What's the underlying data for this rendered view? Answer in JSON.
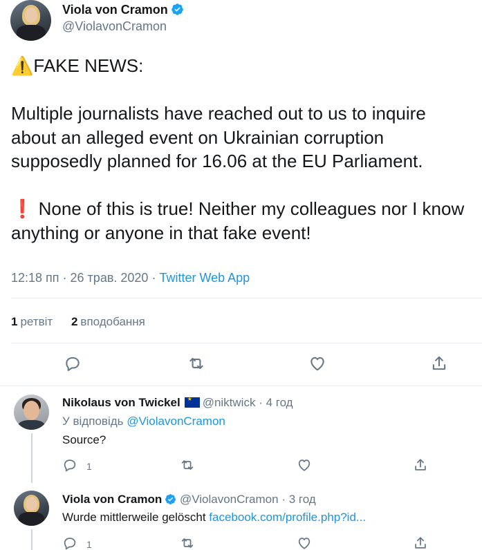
{
  "main_tweet": {
    "author_name": "Viola von Cramon",
    "author_handle": "@ViolavonCramon",
    "text": "⚠️FAKE NEWS:\n\nMultiple journalists have reached out to us to inquire about an alleged event on Ukrainian corruption supposedly planned for 16.06 at the EU Parliament.\n\n❗ None of this is true! Neither my colleagues nor I know anything or anyone in that fake event!",
    "timestamp": "12:18 пп · 26 трав. 2020",
    "separator": " · ",
    "source": "Twitter Web App",
    "retweets_count": "1",
    "retweets_label": "ретвіт",
    "likes_count": "2",
    "likes_label": "вподобання"
  },
  "replies": [
    {
      "author_name": "Nikolaus von Twickel",
      "author_handle": "@niktwick",
      "time": "· 4 год",
      "replying_prefix": "У відповідь",
      "replying_to": "@ViolavonCramon",
      "text": "Source?",
      "reply_count": "1",
      "flag_icon": "eu-flag-icon"
    },
    {
      "author_name": "Viola von Cramon",
      "author_handle": "@ViolavonCramon",
      "time": "· 3 год",
      "text": "Wurde mittlerweile gelöscht",
      "link": "facebook.com/profile.php?id...",
      "reply_count": "1"
    }
  ],
  "colors": {
    "accent": "#1b95e0",
    "secondary_text": "#657786",
    "primary_text": "#14171a",
    "divider": "#e6ecf0",
    "verified": "#1da1f2"
  }
}
